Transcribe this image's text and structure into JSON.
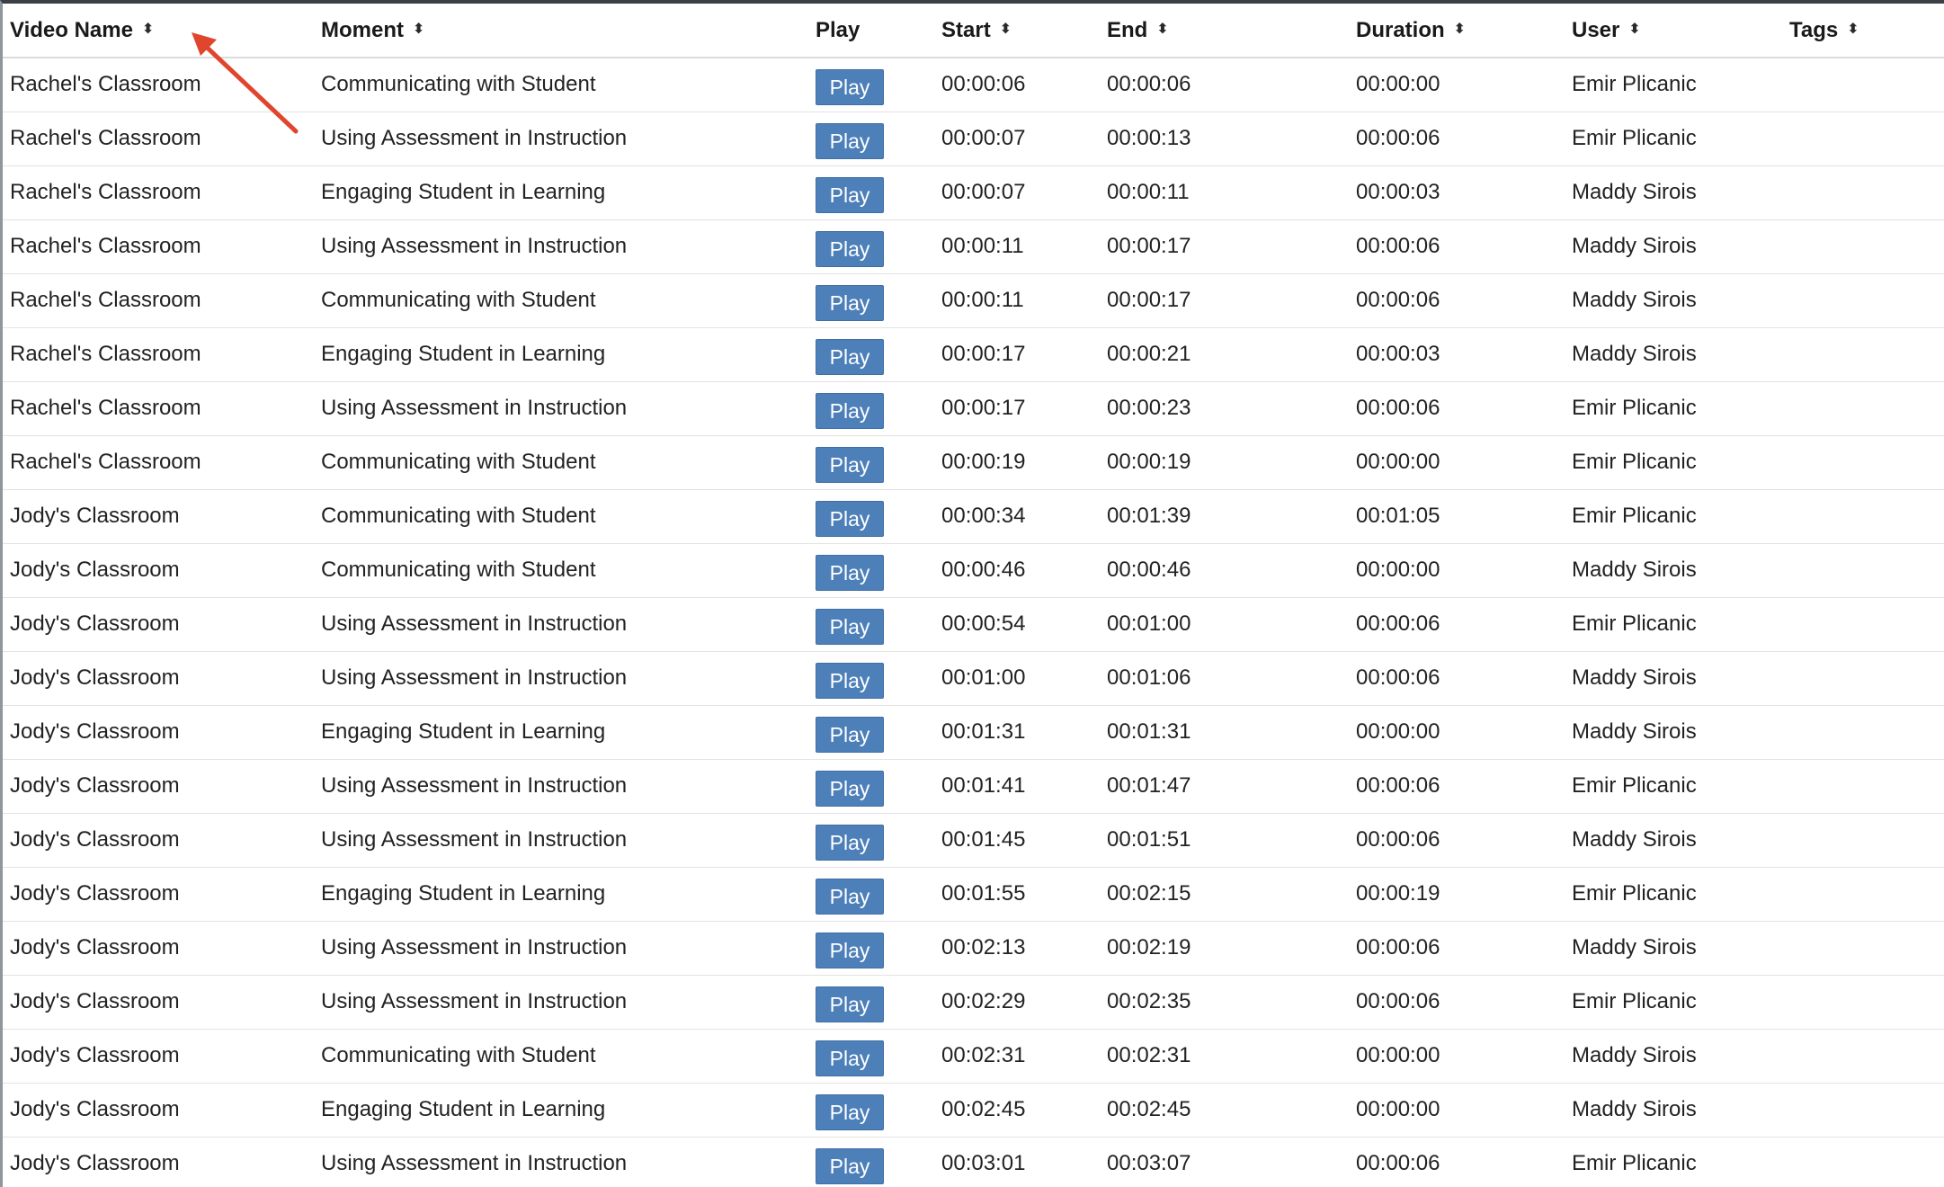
{
  "columns": [
    {
      "label": "Video Name",
      "sortable": true
    },
    {
      "label": "Moment",
      "sortable": true
    },
    {
      "label": "Play",
      "sortable": false
    },
    {
      "label": "Start",
      "sortable": true
    },
    {
      "label": "End",
      "sortable": true
    },
    {
      "label": "Duration",
      "sortable": true
    },
    {
      "label": "User",
      "sortable": true
    },
    {
      "label": "Tags",
      "sortable": true
    }
  ],
  "sort_glyph": "⬍",
  "play_label": "Play",
  "colors": {
    "play_button": "#4d7fb9",
    "annotation_arrow": "#e0452d"
  },
  "rows": [
    {
      "video": "Rachel's Classroom",
      "moment": "Communicating with Student",
      "start": "00:00:06",
      "end": "00:00:06",
      "duration": "00:00:00",
      "user": "Emir Plicanic",
      "tags": ""
    },
    {
      "video": "Rachel's Classroom",
      "moment": "Using Assessment in Instruction",
      "start": "00:00:07",
      "end": "00:00:13",
      "duration": "00:00:06",
      "user": "Emir Plicanic",
      "tags": ""
    },
    {
      "video": "Rachel's Classroom",
      "moment": "Engaging Student in Learning",
      "start": "00:00:07",
      "end": "00:00:11",
      "duration": "00:00:03",
      "user": "Maddy Sirois",
      "tags": ""
    },
    {
      "video": "Rachel's Classroom",
      "moment": "Using Assessment in Instruction",
      "start": "00:00:11",
      "end": "00:00:17",
      "duration": "00:00:06",
      "user": "Maddy Sirois",
      "tags": ""
    },
    {
      "video": "Rachel's Classroom",
      "moment": "Communicating with Student",
      "start": "00:00:11",
      "end": "00:00:17",
      "duration": "00:00:06",
      "user": "Maddy Sirois",
      "tags": ""
    },
    {
      "video": "Rachel's Classroom",
      "moment": "Engaging Student in Learning",
      "start": "00:00:17",
      "end": "00:00:21",
      "duration": "00:00:03",
      "user": "Maddy Sirois",
      "tags": ""
    },
    {
      "video": "Rachel's Classroom",
      "moment": "Using Assessment in Instruction",
      "start": "00:00:17",
      "end": "00:00:23",
      "duration": "00:00:06",
      "user": "Emir Plicanic",
      "tags": ""
    },
    {
      "video": "Rachel's Classroom",
      "moment": "Communicating with Student",
      "start": "00:00:19",
      "end": "00:00:19",
      "duration": "00:00:00",
      "user": "Emir Plicanic",
      "tags": ""
    },
    {
      "video": "Jody's Classroom",
      "moment": "Communicating with Student",
      "start": "00:00:34",
      "end": "00:01:39",
      "duration": "00:01:05",
      "user": "Emir Plicanic",
      "tags": ""
    },
    {
      "video": "Jody's Classroom",
      "moment": "Communicating with Student",
      "start": "00:00:46",
      "end": "00:00:46",
      "duration": "00:00:00",
      "user": "Maddy Sirois",
      "tags": ""
    },
    {
      "video": "Jody's Classroom",
      "moment": "Using Assessment in Instruction",
      "start": "00:00:54",
      "end": "00:01:00",
      "duration": "00:00:06",
      "user": "Emir Plicanic",
      "tags": ""
    },
    {
      "video": "Jody's Classroom",
      "moment": "Using Assessment in Instruction",
      "start": "00:01:00",
      "end": "00:01:06",
      "duration": "00:00:06",
      "user": "Maddy Sirois",
      "tags": ""
    },
    {
      "video": "Jody's Classroom",
      "moment": "Engaging Student in Learning",
      "start": "00:01:31",
      "end": "00:01:31",
      "duration": "00:00:00",
      "user": "Maddy Sirois",
      "tags": ""
    },
    {
      "video": "Jody's Classroom",
      "moment": "Using Assessment in Instruction",
      "start": "00:01:41",
      "end": "00:01:47",
      "duration": "00:00:06",
      "user": "Emir Plicanic",
      "tags": ""
    },
    {
      "video": "Jody's Classroom",
      "moment": "Using Assessment in Instruction",
      "start": "00:01:45",
      "end": "00:01:51",
      "duration": "00:00:06",
      "user": "Maddy Sirois",
      "tags": ""
    },
    {
      "video": "Jody's Classroom",
      "moment": "Engaging Student in Learning",
      "start": "00:01:55",
      "end": "00:02:15",
      "duration": "00:00:19",
      "user": "Emir Plicanic",
      "tags": ""
    },
    {
      "video": "Jody's Classroom",
      "moment": "Using Assessment in Instruction",
      "start": "00:02:13",
      "end": "00:02:19",
      "duration": "00:00:06",
      "user": "Maddy Sirois",
      "tags": ""
    },
    {
      "video": "Jody's Classroom",
      "moment": "Using Assessment in Instruction",
      "start": "00:02:29",
      "end": "00:02:35",
      "duration": "00:00:06",
      "user": "Emir Plicanic",
      "tags": ""
    },
    {
      "video": "Jody's Classroom",
      "moment": "Communicating with Student",
      "start": "00:02:31",
      "end": "00:02:31",
      "duration": "00:00:00",
      "user": "Maddy Sirois",
      "tags": ""
    },
    {
      "video": "Jody's Classroom",
      "moment": "Engaging Student in Learning",
      "start": "00:02:45",
      "end": "00:02:45",
      "duration": "00:00:00",
      "user": "Maddy Sirois",
      "tags": ""
    },
    {
      "video": "Jody's Classroom",
      "moment": "Using Assessment in Instruction",
      "start": "00:03:01",
      "end": "00:03:07",
      "duration": "00:00:06",
      "user": "Emir Plicanic",
      "tags": ""
    }
  ]
}
